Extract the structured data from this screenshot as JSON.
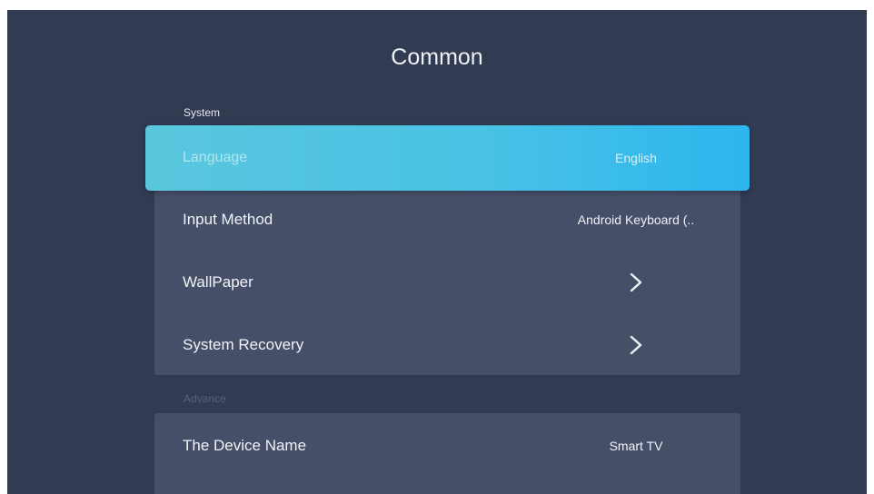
{
  "page": {
    "title": "Common"
  },
  "sections": {
    "system": {
      "label": "System",
      "items": [
        {
          "label": "Language",
          "value": "English"
        },
        {
          "label": "Input Method",
          "value": "Android Keyboard (.."
        },
        {
          "label": "WallPaper",
          "icon": "chevron-right-icon"
        },
        {
          "label": "System Recovery",
          "icon": "chevron-right-icon"
        }
      ]
    },
    "advance": {
      "label": "Advance",
      "items": [
        {
          "label": "The Device Name",
          "value": "Smart TV"
        }
      ]
    }
  },
  "colors": {
    "background": "#313b52",
    "panel": "#454f68",
    "focus_start": "#5ac7dd",
    "focus_end": "#2db6ee",
    "text": "#f1f3f7",
    "muted_section": "#58627a"
  }
}
